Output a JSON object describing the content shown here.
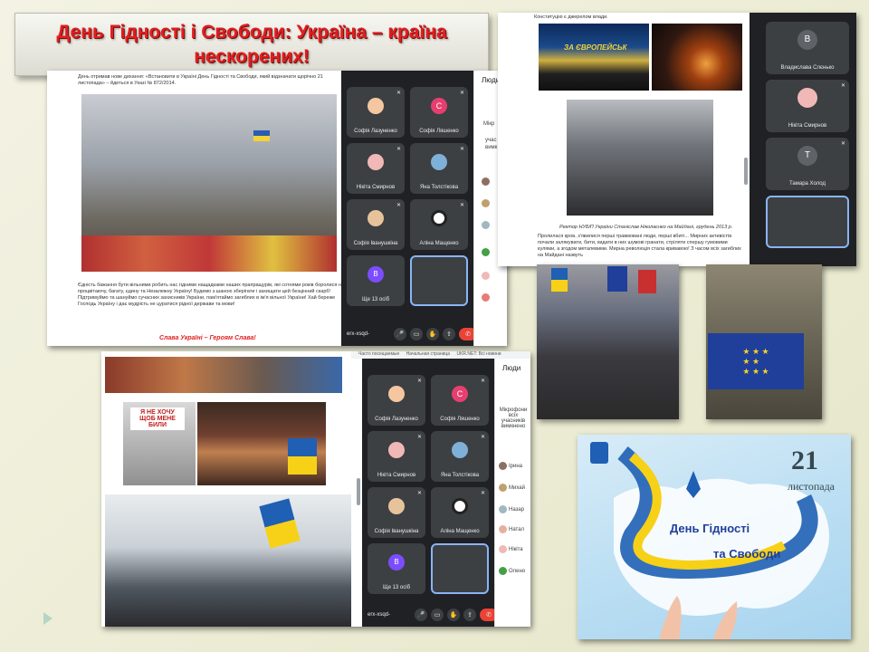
{
  "title": "День Гідності і Свободи: Україна – країна нескорених!",
  "screen1": {
    "doc_intro": "День отримав нове дихання: «Встановити в Україні День Гідності та Свободи, який відзначати щорічно 21 листопада» – йдеться в Указі № 872/2014.",
    "doc_body": "Єдність бажання бути вільними робить нас гідними нащадками наших прапращурів, які сотнями років боролися на процвітаючу, багату, єдину та Незалежну Україну! Будемо з шаною зберігати і захищати цей безцінний скарб! Підтримуймо та шануймо сучасних захисників України, пам'ятаймо загиблих в ім'я вільної України! Хай береже Господь Україну і дає мудрість не цуратися рідної держави та мови!",
    "slogan": "Слава Україні – Героям Слава!",
    "tiles": [
      {
        "name": "Софія Лазуненко",
        "color": "#f4c7a0"
      },
      {
        "name": "Софія Ляшенко",
        "color": "#e63f6f",
        "initial": "С"
      },
      {
        "name": "Нікіта Смирнов",
        "color": "#f1b8b8"
      },
      {
        "name": "Яна Толстікова",
        "color": "#7fb0d8"
      },
      {
        "name": "Софія Іванушкіна",
        "color": "#e7c39b"
      },
      {
        "name": "Аліна Мащенко",
        "color": "#ffffff"
      }
    ],
    "more": "Ще 13 осіб",
    "more_initial": "В",
    "meeting_code": "erx-xsqd-",
    "people_header": "Люди",
    "people_partial": [
      "Мікр",
      "учас",
      "вимк",
      "Ірин",
      "Міха",
      "Наза",
      "Нат",
      "Нік",
      "Олен"
    ]
  },
  "screen2": {
    "top_caption": "Конституцію є джерелом влади.",
    "stage_sign": "ЗА ЄВРОПЕЙСЬК",
    "photo_caption": "Ректор НУБіП України Станіслав Ніколаєнко на Майдані, грудень 2013 р.",
    "doc_text": "Пролилася кров, з'явилися перші травмовані люди, перші вбиті... Мирних активістів почали залякувати, бити, кидати в них шумові гранати, стріляти спершу гумовими кулями, а згодом металевими. Мирна революція стала кривавою! З часом всіх загиблих на Майдані назвуть",
    "tiles": [
      {
        "name": "Владислава Слєнько",
        "color": "#3c4043",
        "initial": "В"
      },
      {
        "name": "Нікіта Смирнов",
        "color": "#f1b8b8"
      },
      {
        "name": "Тамара Холод",
        "color": "#3c4043",
        "initial": "Т"
      }
    ]
  },
  "screen3": {
    "browser_tabs": [
      "Часто посещаемые",
      "Начальная страница",
      "UKR.NET: Всі новини"
    ],
    "sign_text": "Я НЕ ХОЧУ ЩОБ МЕНЕ БИЛИ",
    "tiles": [
      {
        "name": "Софія Лазуненко",
        "color": "#f4c7a0"
      },
      {
        "name": "Софія Ляшенко",
        "color": "#e63f6f",
        "initial": "С"
      },
      {
        "name": "Нікіта Смирнов",
        "color": "#f1b8b8"
      },
      {
        "name": "Яна Толстікова",
        "color": "#7fb0d8"
      },
      {
        "name": "Софія Іванушкіна",
        "color": "#e7c39b"
      },
      {
        "name": "Аліна Мащенко",
        "color": "#ffffff"
      }
    ],
    "more": "Ще 13 осіб",
    "more_initial": "В",
    "meeting_code": "erx-xsqd-",
    "people_header": "Люди",
    "mic_notice": "Мікрофони всіх учасників вимкнено",
    "people": [
      "Ірина",
      "Михай",
      "Назар",
      "Натал",
      "Нікіта",
      "Олено"
    ]
  },
  "day_card": {
    "number": "21",
    "month": "листопада",
    "line1": "День Гідності",
    "line2": "та Свободи"
  },
  "colors": {
    "title_red": "#e21e1e",
    "meet_bg": "#202124",
    "ua_blue": "#1f5fb4",
    "ua_yellow": "#f7d117"
  }
}
